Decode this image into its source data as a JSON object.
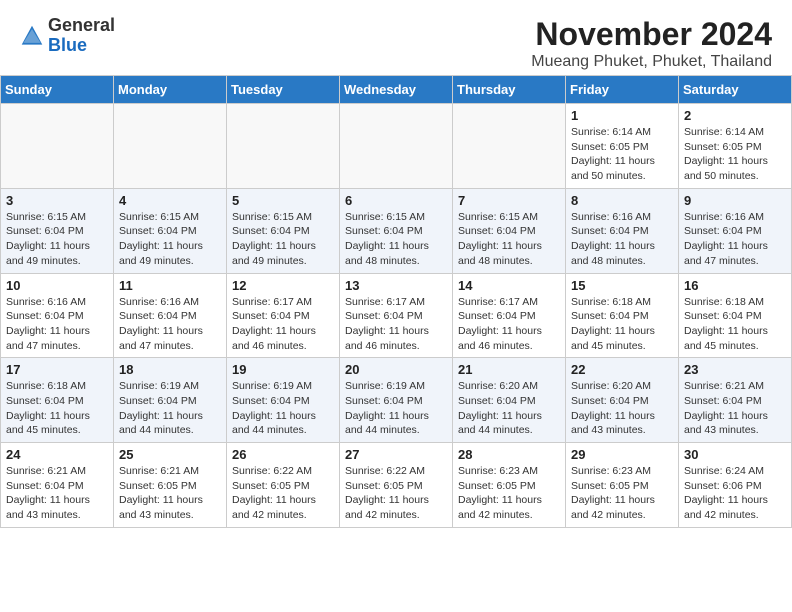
{
  "header": {
    "logo_general": "General",
    "logo_blue": "Blue",
    "month_year": "November 2024",
    "location": "Mueang Phuket, Phuket, Thailand"
  },
  "days_of_week": [
    "Sunday",
    "Monday",
    "Tuesday",
    "Wednesday",
    "Thursday",
    "Friday",
    "Saturday"
  ],
  "weeks": [
    {
      "days": [
        {
          "num": "",
          "info": ""
        },
        {
          "num": "",
          "info": ""
        },
        {
          "num": "",
          "info": ""
        },
        {
          "num": "",
          "info": ""
        },
        {
          "num": "",
          "info": ""
        },
        {
          "num": "1",
          "info": "Sunrise: 6:14 AM\nSunset: 6:05 PM\nDaylight: 11 hours\nand 50 minutes."
        },
        {
          "num": "2",
          "info": "Sunrise: 6:14 AM\nSunset: 6:05 PM\nDaylight: 11 hours\nand 50 minutes."
        }
      ]
    },
    {
      "days": [
        {
          "num": "3",
          "info": "Sunrise: 6:15 AM\nSunset: 6:04 PM\nDaylight: 11 hours\nand 49 minutes."
        },
        {
          "num": "4",
          "info": "Sunrise: 6:15 AM\nSunset: 6:04 PM\nDaylight: 11 hours\nand 49 minutes."
        },
        {
          "num": "5",
          "info": "Sunrise: 6:15 AM\nSunset: 6:04 PM\nDaylight: 11 hours\nand 49 minutes."
        },
        {
          "num": "6",
          "info": "Sunrise: 6:15 AM\nSunset: 6:04 PM\nDaylight: 11 hours\nand 48 minutes."
        },
        {
          "num": "7",
          "info": "Sunrise: 6:15 AM\nSunset: 6:04 PM\nDaylight: 11 hours\nand 48 minutes."
        },
        {
          "num": "8",
          "info": "Sunrise: 6:16 AM\nSunset: 6:04 PM\nDaylight: 11 hours\nand 48 minutes."
        },
        {
          "num": "9",
          "info": "Sunrise: 6:16 AM\nSunset: 6:04 PM\nDaylight: 11 hours\nand 47 minutes."
        }
      ]
    },
    {
      "days": [
        {
          "num": "10",
          "info": "Sunrise: 6:16 AM\nSunset: 6:04 PM\nDaylight: 11 hours\nand 47 minutes."
        },
        {
          "num": "11",
          "info": "Sunrise: 6:16 AM\nSunset: 6:04 PM\nDaylight: 11 hours\nand 47 minutes."
        },
        {
          "num": "12",
          "info": "Sunrise: 6:17 AM\nSunset: 6:04 PM\nDaylight: 11 hours\nand 46 minutes."
        },
        {
          "num": "13",
          "info": "Sunrise: 6:17 AM\nSunset: 6:04 PM\nDaylight: 11 hours\nand 46 minutes."
        },
        {
          "num": "14",
          "info": "Sunrise: 6:17 AM\nSunset: 6:04 PM\nDaylight: 11 hours\nand 46 minutes."
        },
        {
          "num": "15",
          "info": "Sunrise: 6:18 AM\nSunset: 6:04 PM\nDaylight: 11 hours\nand 45 minutes."
        },
        {
          "num": "16",
          "info": "Sunrise: 6:18 AM\nSunset: 6:04 PM\nDaylight: 11 hours\nand 45 minutes."
        }
      ]
    },
    {
      "days": [
        {
          "num": "17",
          "info": "Sunrise: 6:18 AM\nSunset: 6:04 PM\nDaylight: 11 hours\nand 45 minutes."
        },
        {
          "num": "18",
          "info": "Sunrise: 6:19 AM\nSunset: 6:04 PM\nDaylight: 11 hours\nand 44 minutes."
        },
        {
          "num": "19",
          "info": "Sunrise: 6:19 AM\nSunset: 6:04 PM\nDaylight: 11 hours\nand 44 minutes."
        },
        {
          "num": "20",
          "info": "Sunrise: 6:19 AM\nSunset: 6:04 PM\nDaylight: 11 hours\nand 44 minutes."
        },
        {
          "num": "21",
          "info": "Sunrise: 6:20 AM\nSunset: 6:04 PM\nDaylight: 11 hours\nand 44 minutes."
        },
        {
          "num": "22",
          "info": "Sunrise: 6:20 AM\nSunset: 6:04 PM\nDaylight: 11 hours\nand 43 minutes."
        },
        {
          "num": "23",
          "info": "Sunrise: 6:21 AM\nSunset: 6:04 PM\nDaylight: 11 hours\nand 43 minutes."
        }
      ]
    },
    {
      "days": [
        {
          "num": "24",
          "info": "Sunrise: 6:21 AM\nSunset: 6:04 PM\nDaylight: 11 hours\nand 43 minutes."
        },
        {
          "num": "25",
          "info": "Sunrise: 6:21 AM\nSunset: 6:05 PM\nDaylight: 11 hours\nand 43 minutes."
        },
        {
          "num": "26",
          "info": "Sunrise: 6:22 AM\nSunset: 6:05 PM\nDaylight: 11 hours\nand 42 minutes."
        },
        {
          "num": "27",
          "info": "Sunrise: 6:22 AM\nSunset: 6:05 PM\nDaylight: 11 hours\nand 42 minutes."
        },
        {
          "num": "28",
          "info": "Sunrise: 6:23 AM\nSunset: 6:05 PM\nDaylight: 11 hours\nand 42 minutes."
        },
        {
          "num": "29",
          "info": "Sunrise: 6:23 AM\nSunset: 6:05 PM\nDaylight: 11 hours\nand 42 minutes."
        },
        {
          "num": "30",
          "info": "Sunrise: 6:24 AM\nSunset: 6:06 PM\nDaylight: 11 hours\nand 42 minutes."
        }
      ]
    }
  ]
}
